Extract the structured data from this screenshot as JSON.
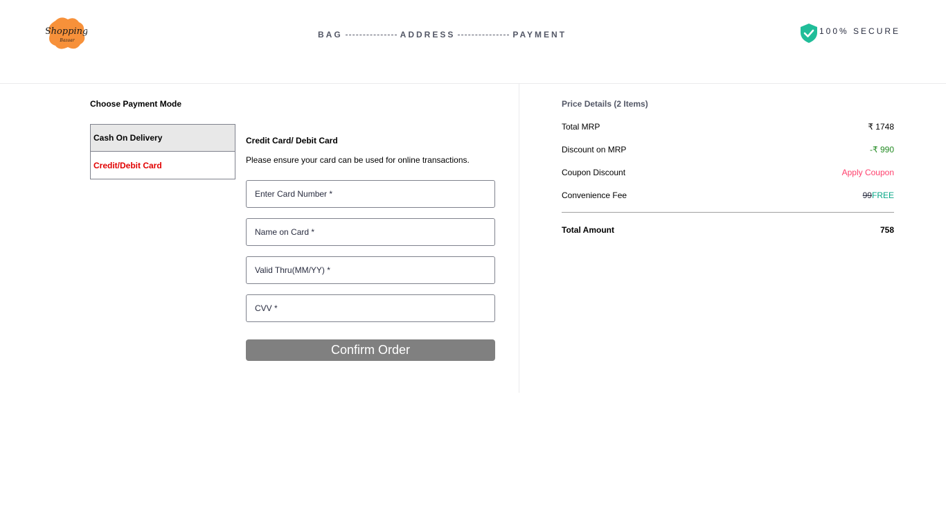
{
  "header": {
    "logo_text": "Shopping",
    "logo_subtext": "Bazaar",
    "steps": [
      "BAG",
      "ADDRESS",
      "PAYMENT"
    ],
    "secure_label": "100% SECURE",
    "secure_icon": "shield-check-icon",
    "secure_color": "#20bd99",
    "logo_color": "#f7913a"
  },
  "payment": {
    "title": "Choose Payment Mode",
    "tabs": [
      {
        "label": "Cash On Delivery",
        "active": true
      },
      {
        "label": "Credit/Debit Card",
        "active": false
      }
    ],
    "card_title": "Credit Card/ Debit Card",
    "card_note": "Please ensure your card can be used for online transactions.",
    "fields": {
      "card_number": {
        "placeholder": "Enter Card Number *",
        "value": ""
      },
      "name_on_card": {
        "placeholder": "Name on Card *",
        "value": ""
      },
      "valid_thru": {
        "placeholder": "Valid Thru(MM/YY) *",
        "value": ""
      },
      "cvv": {
        "placeholder": "CVV *",
        "value": ""
      }
    },
    "confirm_label": "Confirm Order"
  },
  "price": {
    "title": "Price Details (2 Items)",
    "rows": [
      {
        "label": "Total MRP",
        "value": "₹ 1748"
      },
      {
        "label": "Discount on MRP",
        "value": "-₹ 990"
      },
      {
        "label": "Coupon Discount",
        "value": "Apply Coupon"
      },
      {
        "label": "Convenience Fee",
        "old_value": "99",
        "value": "FREE"
      }
    ],
    "total_label": "Total Amount",
    "total_value": "758"
  }
}
